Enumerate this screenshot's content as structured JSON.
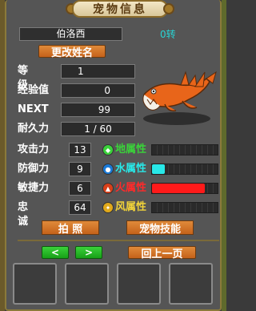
{
  "window": {
    "title": "宠物信息"
  },
  "pet": {
    "name": "伯洛西",
    "rebirth": "0转",
    "rename_label": "更改姓名",
    "stats": [
      {
        "key": "level",
        "label": "等 级",
        "value": "1"
      },
      {
        "key": "exp",
        "label": "经验值",
        "value": "0"
      },
      {
        "key": "next",
        "label": "NEXT",
        "value": "99"
      },
      {
        "key": "durability",
        "label": "耐久力",
        "value": "1  /  60"
      }
    ],
    "combat": [
      {
        "key": "attack",
        "label": "攻击力",
        "value": "13"
      },
      {
        "key": "defense",
        "label": "防御力",
        "value": "9"
      },
      {
        "key": "agility",
        "label": "敏捷力",
        "value": "6"
      },
      {
        "key": "loyalty",
        "label": "忠 诚",
        "value": "64"
      }
    ],
    "elements": [
      {
        "key": "earth",
        "label": "地属性",
        "color": "#3ad23a",
        "icon": "earth-icon",
        "level": 0
      },
      {
        "key": "water",
        "label": "水属性",
        "color": "#28e8e8",
        "icon": "water-icon",
        "level": 0.2
      },
      {
        "key": "fire",
        "label": "火属性",
        "color": "#ff1a1a",
        "icon": "fire-icon",
        "level": 0.8
      },
      {
        "key": "wind",
        "label": "风属性",
        "color": "#f0d23a",
        "icon": "wind-icon",
        "level": 0
      }
    ]
  },
  "actions": {
    "photo": "拍  照",
    "skills": "宠物技能",
    "prev": "<",
    "next": ">",
    "back": "回上一页"
  },
  "colors": {
    "button_orange": "#d9741f",
    "nav_green": "#2cc42c"
  }
}
